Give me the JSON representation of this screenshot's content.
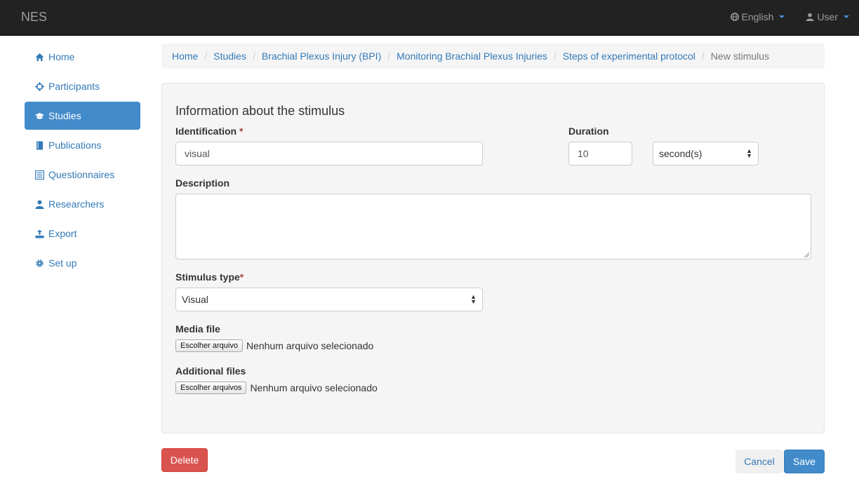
{
  "navbar": {
    "brand": "NES",
    "language": "English",
    "user": "User"
  },
  "sidebar": {
    "items": [
      {
        "label": "Home",
        "icon": "home-icon",
        "active": false
      },
      {
        "label": "Participants",
        "icon": "crosshair-icon",
        "active": false
      },
      {
        "label": "Studies",
        "icon": "graduation-cap-icon",
        "active": true
      },
      {
        "label": "Publications",
        "icon": "book-icon",
        "active": false
      },
      {
        "label": "Questionnaires",
        "icon": "list-icon",
        "active": false
      },
      {
        "label": "Researchers",
        "icon": "user-icon",
        "active": false
      },
      {
        "label": "Export",
        "icon": "export-icon",
        "active": false
      },
      {
        "label": "Set up",
        "icon": "cog-icon",
        "active": false
      }
    ]
  },
  "breadcrumb": {
    "items": [
      "Home",
      "Studies",
      "Brachial Plexus Injury (BPI)",
      "Monitoring Brachial Plexus Injuries",
      "Steps of experimental protocol"
    ],
    "current": "New stimulus",
    "separator": "/"
  },
  "form": {
    "title": "Information about the stimulus",
    "identification_label": "Identification",
    "required_mark": "*",
    "identification_value": "visual",
    "duration_label": "Duration",
    "duration_value": "10",
    "duration_unit": "second(s)",
    "description_label": "Description",
    "description_value": "",
    "stimulus_type_label": "Stimulus type",
    "stimulus_type_value": "Visual",
    "media_file_label": "Media file",
    "media_file_button": "Escolher arquivo",
    "media_file_status": "Nenhum arquivo selecionado",
    "additional_files_label": "Additional files",
    "additional_files_button": "Escolher arquivos",
    "additional_files_status": "Nenhum arquivo selecionado"
  },
  "actions": {
    "delete": "Delete",
    "cancel": "Cancel",
    "save": "Save"
  },
  "colors": {
    "navbar": "#222222",
    "link": "#337ab7",
    "active": "#428bca",
    "danger": "#d9534f",
    "required": "#a94442"
  }
}
